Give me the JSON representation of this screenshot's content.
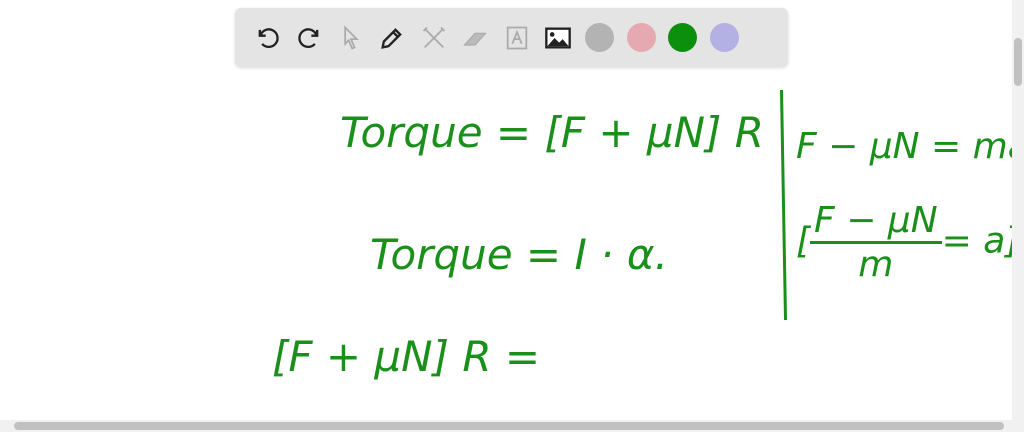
{
  "toolbar": {
    "tools": [
      "undo-icon",
      "redo-icon",
      "select-icon",
      "pen-icon",
      "tools-icon",
      "eraser-icon",
      "text-icon",
      "image-icon"
    ],
    "colors": [
      "#b3b3b3",
      "#e5a9b2",
      "#0c8f0c",
      "#b3b0e4"
    ]
  },
  "board": {
    "line1": "Torque = [F + μN] R",
    "line2": "Torque =  I · α.",
    "line3": "[F + μN] R =",
    "right1": "F − μN = ma",
    "right2_num": "F − μN",
    "right2_den": "m",
    "right2_rhs": "= a"
  }
}
